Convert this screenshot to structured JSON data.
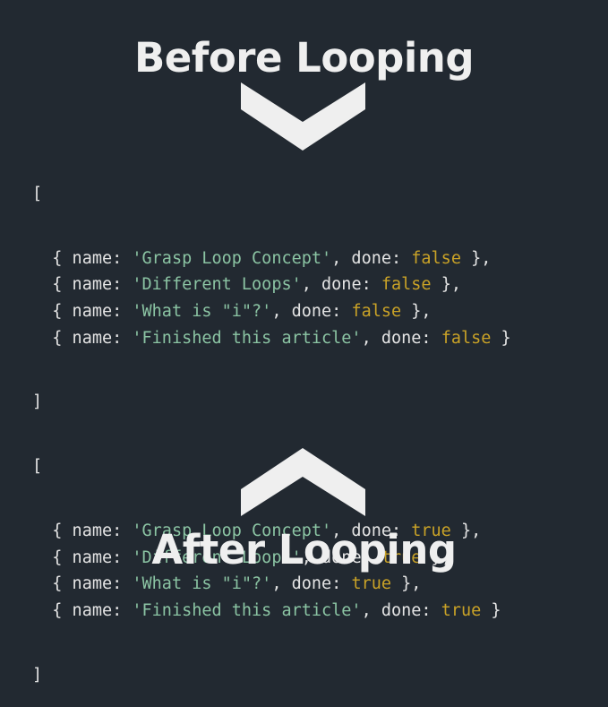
{
  "headings": {
    "top": "Before Looping",
    "bottom": "After Looping"
  },
  "colors": {
    "background": "#222931",
    "heading": "#efefef",
    "string": "#8bc4a3",
    "boolean": "#c9a227",
    "plain": "#e4e4e4"
  },
  "icons": {
    "top": "chevron-down-icon",
    "bottom": "chevron-up-icon"
  },
  "code": {
    "open_bracket": "[",
    "close_bracket": "]",
    "before": [
      {
        "name": "'Grasp Loop Concept'",
        "done": "false",
        "tail": " },"
      },
      {
        "name": "'Different Loops'",
        "done": "false",
        "tail": " },"
      },
      {
        "name": "'What is \"i\"?'",
        "done": "false",
        "tail": " },"
      },
      {
        "name": "'Finished this article'",
        "done": "false",
        "tail": " }"
      }
    ],
    "after": [
      {
        "name": "'Grasp Loop Concept'",
        "done": "true",
        "tail": " },"
      },
      {
        "name": "'Different Loops'",
        "done": "true",
        "tail": " },"
      },
      {
        "name": "'What is \"i\"?'",
        "done": "true",
        "tail": " },"
      },
      {
        "name": "'Finished this article'",
        "done": "true",
        "tail": " }"
      }
    ],
    "prefix": "  { name: ",
    "mid": ", done: "
  }
}
